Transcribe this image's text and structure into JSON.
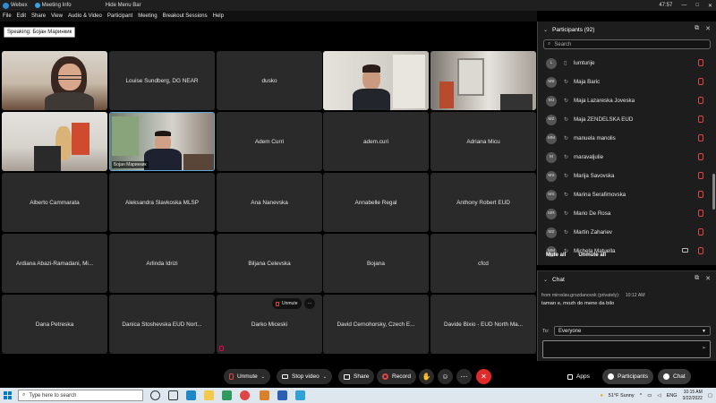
{
  "titlebar": {
    "app": "Webex",
    "meeting_info": "Meeting Info",
    "hide_menu": "Hide Menu Bar",
    "time": "47:57"
  },
  "menu": [
    "File",
    "Edit",
    "Share",
    "View",
    "Audio & Video",
    "Participant",
    "Meeting",
    "Breakout Sessions",
    "Help"
  ],
  "speaking": "Speaking: Бојан Маринкик",
  "tiles": [
    {
      "name": "",
      "type": "video-woman-glasses"
    },
    {
      "name": "Louise Sundberg, DG NEAR"
    },
    {
      "name": "dusko"
    },
    {
      "name": "",
      "type": "video-man-beard"
    },
    {
      "name": "",
      "type": "video-room"
    },
    {
      "name": "",
      "type": "video-blonde"
    },
    {
      "name": "",
      "type": "video-active",
      "tag": "Бојан Маринкик"
    },
    {
      "name": "Adem Curri"
    },
    {
      "name": "adem.curi"
    },
    {
      "name": "Adriana Micu"
    },
    {
      "name": "Alberto Cammarata"
    },
    {
      "name": "Aleksandra Slavkoska MLSP"
    },
    {
      "name": "Ana Nanevska"
    },
    {
      "name": "Annabelle Regal"
    },
    {
      "name": "Anthony Robert EUD"
    },
    {
      "name": "Ardiana Abazi-Ramadani, Mi..."
    },
    {
      "name": "Arlinda Idrizi"
    },
    {
      "name": "Biljana Celevska"
    },
    {
      "name": "Bojana"
    },
    {
      "name": "cfcd"
    },
    {
      "name": "Dana Petreska"
    },
    {
      "name": "Danica Stoshevska EUD Nort..."
    },
    {
      "name": "Darko Miceski"
    },
    {
      "name": "David Cernohorsky, Czech E..."
    },
    {
      "name": "Davide Bixio - EUD North Ma..."
    }
  ],
  "tile_overlay": {
    "unmute": "Unmute",
    "more": "···"
  },
  "controls": {
    "unmute": "Unmute",
    "stop_video": "Stop video",
    "share": "Share",
    "record": "Record",
    "apps": "Apps",
    "participants": "Participants",
    "chat": "Chat"
  },
  "participants": {
    "title": "Participants (92)",
    "search_placeholder": "Search",
    "list": [
      {
        "initials": "L",
        "name": "lumturije",
        "video": false
      },
      {
        "initials": "MB",
        "name": "Maja Baric",
        "video": false
      },
      {
        "initials": "MJ",
        "name": "Maja Lazareska Joveska",
        "video": false
      },
      {
        "initials": "MZ",
        "name": "Maja ZENDELSKA EUD",
        "video": false
      },
      {
        "initials": "MM",
        "name": "manuela manolis",
        "video": false
      },
      {
        "initials": "M",
        "name": "maravaljulie",
        "video": false
      },
      {
        "initials": "MS",
        "name": "Marija Savovska",
        "video": false
      },
      {
        "initials": "MS",
        "name": "Marina Serafimovska",
        "video": false
      },
      {
        "initials": "MR",
        "name": "Mario De Rosa",
        "video": false
      },
      {
        "initials": "MZ",
        "name": "Martin Zahariev",
        "video": false
      },
      {
        "initials": "MM",
        "name": "Michela Matuella",
        "video": true
      }
    ],
    "mute_all": "Mute all",
    "unmute_all": "Unmute all"
  },
  "chat": {
    "title": "Chat",
    "from": "from miroslav.grozdanovsk (privately):",
    "time": "10:12 AM",
    "message": "taman e, mozh do mene da bilo",
    "to_label": "To:",
    "to_value": "Everyone"
  },
  "taskbar": {
    "search_placeholder": "Type here to search",
    "weather": "51°F  Sunny",
    "lang": "ENG",
    "time": "10:15 AM",
    "date": "3/22/2022"
  },
  "colors": {
    "accent": "#5fa8d3",
    "end_call": "#e02b2b",
    "mute_red": "#e04646"
  }
}
